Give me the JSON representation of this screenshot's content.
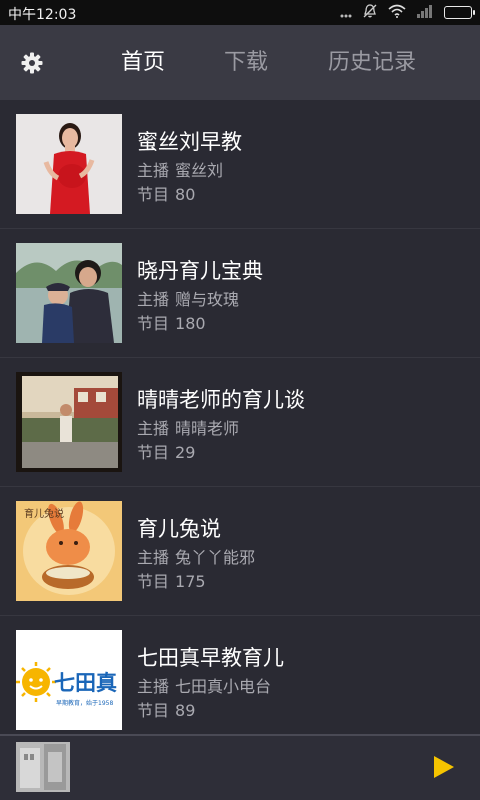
{
  "status_bar": {
    "time": "中午12:03",
    "icons": [
      "more-icon",
      "mute-icon",
      "wifi-icon",
      "signal-icon",
      "battery-icon"
    ],
    "battery_color": "#4ad35a"
  },
  "nav": {
    "settings_icon": "gear-icon",
    "tabs": [
      {
        "label": "首页",
        "active": true
      },
      {
        "label": "下载",
        "active": false
      },
      {
        "label": "历史记录",
        "active": false
      }
    ]
  },
  "list": {
    "host_label": "主播",
    "count_label": "节目",
    "items": [
      {
        "title": "蜜丝刘早教",
        "host": "蜜丝刘",
        "count": "80"
      },
      {
        "title": "晓丹育儿宝典",
        "host": "赠与玫瑰",
        "count": "180"
      },
      {
        "title": "晴晴老师的育儿谈",
        "host": "晴晴老师",
        "count": "29"
      },
      {
        "title": "育儿兔说",
        "host": "兔丫丫能邪",
        "count": "175"
      },
      {
        "title": "七田真早教育儿",
        "host": "七田真小电台",
        "count": "89"
      }
    ]
  },
  "item_logo": {
    "name": "七田真",
    "tagline": "早期教育，始于1958"
  },
  "player": {
    "play_icon": "play-icon",
    "accent": "#f5c400"
  }
}
